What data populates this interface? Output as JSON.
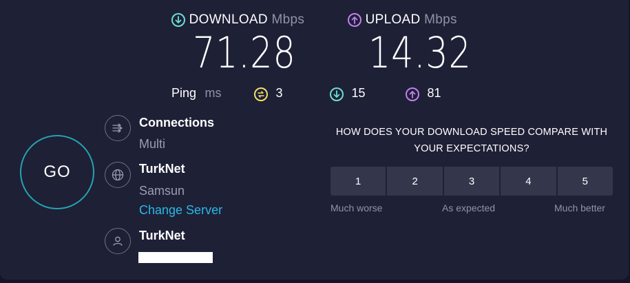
{
  "download": {
    "label": "DOWNLOAD",
    "unit": "Mbps",
    "value": "71.28",
    "icon": "download-arrow-icon"
  },
  "upload": {
    "label": "UPLOAD",
    "unit": "Mbps",
    "value": "14.32",
    "icon": "upload-arrow-icon"
  },
  "ping": {
    "label": "Ping",
    "unit": "ms",
    "jitter": "3",
    "download_latency": "15",
    "upload_latency": "81"
  },
  "go_label": "GO",
  "connections": {
    "title": "Connections",
    "value": "Multi"
  },
  "server": {
    "title": "TurkNet",
    "location": "Samsun",
    "change_label": "Change Server"
  },
  "provider": {
    "title": "TurkNet"
  },
  "survey": {
    "question": "HOW DOES YOUR DOWNLOAD SPEED COMPARE WITH YOUR EXPECTATIONS?",
    "options": [
      "1",
      "2",
      "3",
      "4",
      "5"
    ],
    "low_label": "Much worse",
    "mid_label": "As expected",
    "high_label": "Much better"
  },
  "colors": {
    "background": "#1e2036",
    "download_accent": "#6ae0d6",
    "upload_accent": "#c57ff0",
    "jitter_accent": "#f3e06a",
    "go_ring": "#25a4b0",
    "link": "#29b8e8"
  }
}
